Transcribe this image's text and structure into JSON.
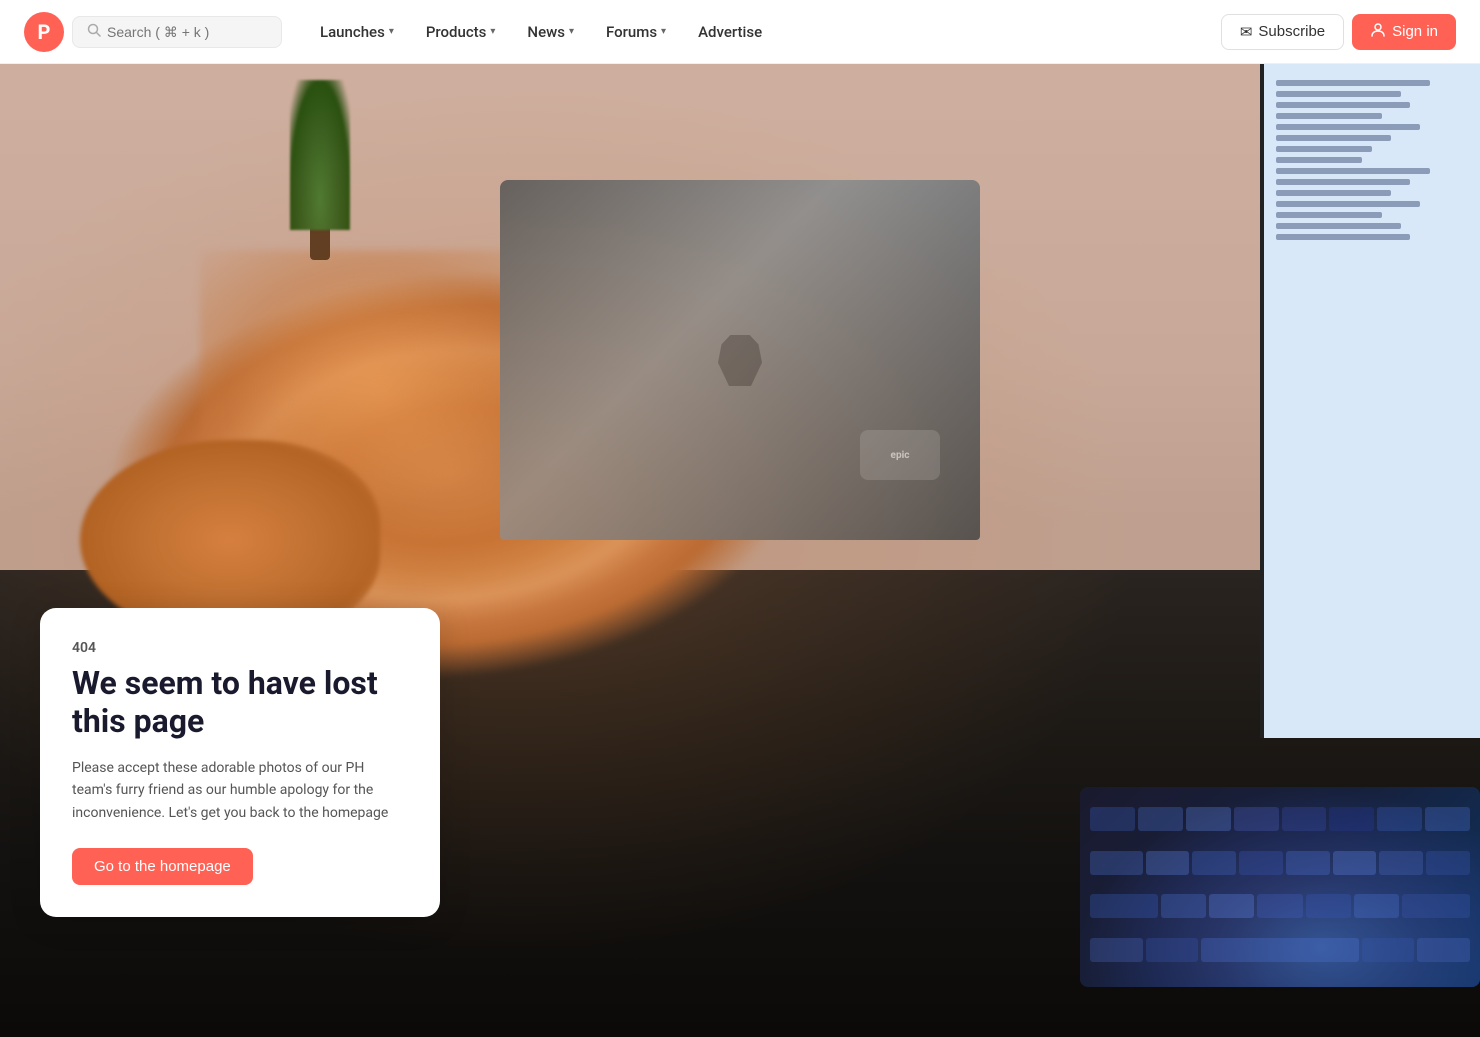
{
  "navbar": {
    "logo_letter": "P",
    "search_placeholder": "Search ( ⌘ + k )",
    "nav_items": [
      {
        "label": "Launches",
        "has_chevron": true
      },
      {
        "label": "Products",
        "has_chevron": true
      },
      {
        "label": "News",
        "has_chevron": true
      },
      {
        "label": "Forums",
        "has_chevron": true
      },
      {
        "label": "Advertise",
        "has_chevron": false
      }
    ],
    "subscribe_label": "Subscribe",
    "signin_label": "Sign in"
  },
  "hero": {
    "alt": "Sleeping orange tabby cat on a desk mousepad in front of a MacBook laptop, with a monitor and RGB keyboard visible"
  },
  "error": {
    "code": "404",
    "title": "We seem to have lost this page",
    "description": "Please accept these adorable photos of our PH team's furry friend as our humble apology for the inconvenience. Let's get you back to the homepage",
    "cta_label": "Go to the homepage"
  },
  "icons": {
    "search": "🔍",
    "subscribe": "✉",
    "signin": "→"
  },
  "colors": {
    "brand_red": "#ff6154",
    "nav_bg": "#ffffff",
    "text_dark": "#1a1a2e",
    "text_muted": "#555555"
  }
}
